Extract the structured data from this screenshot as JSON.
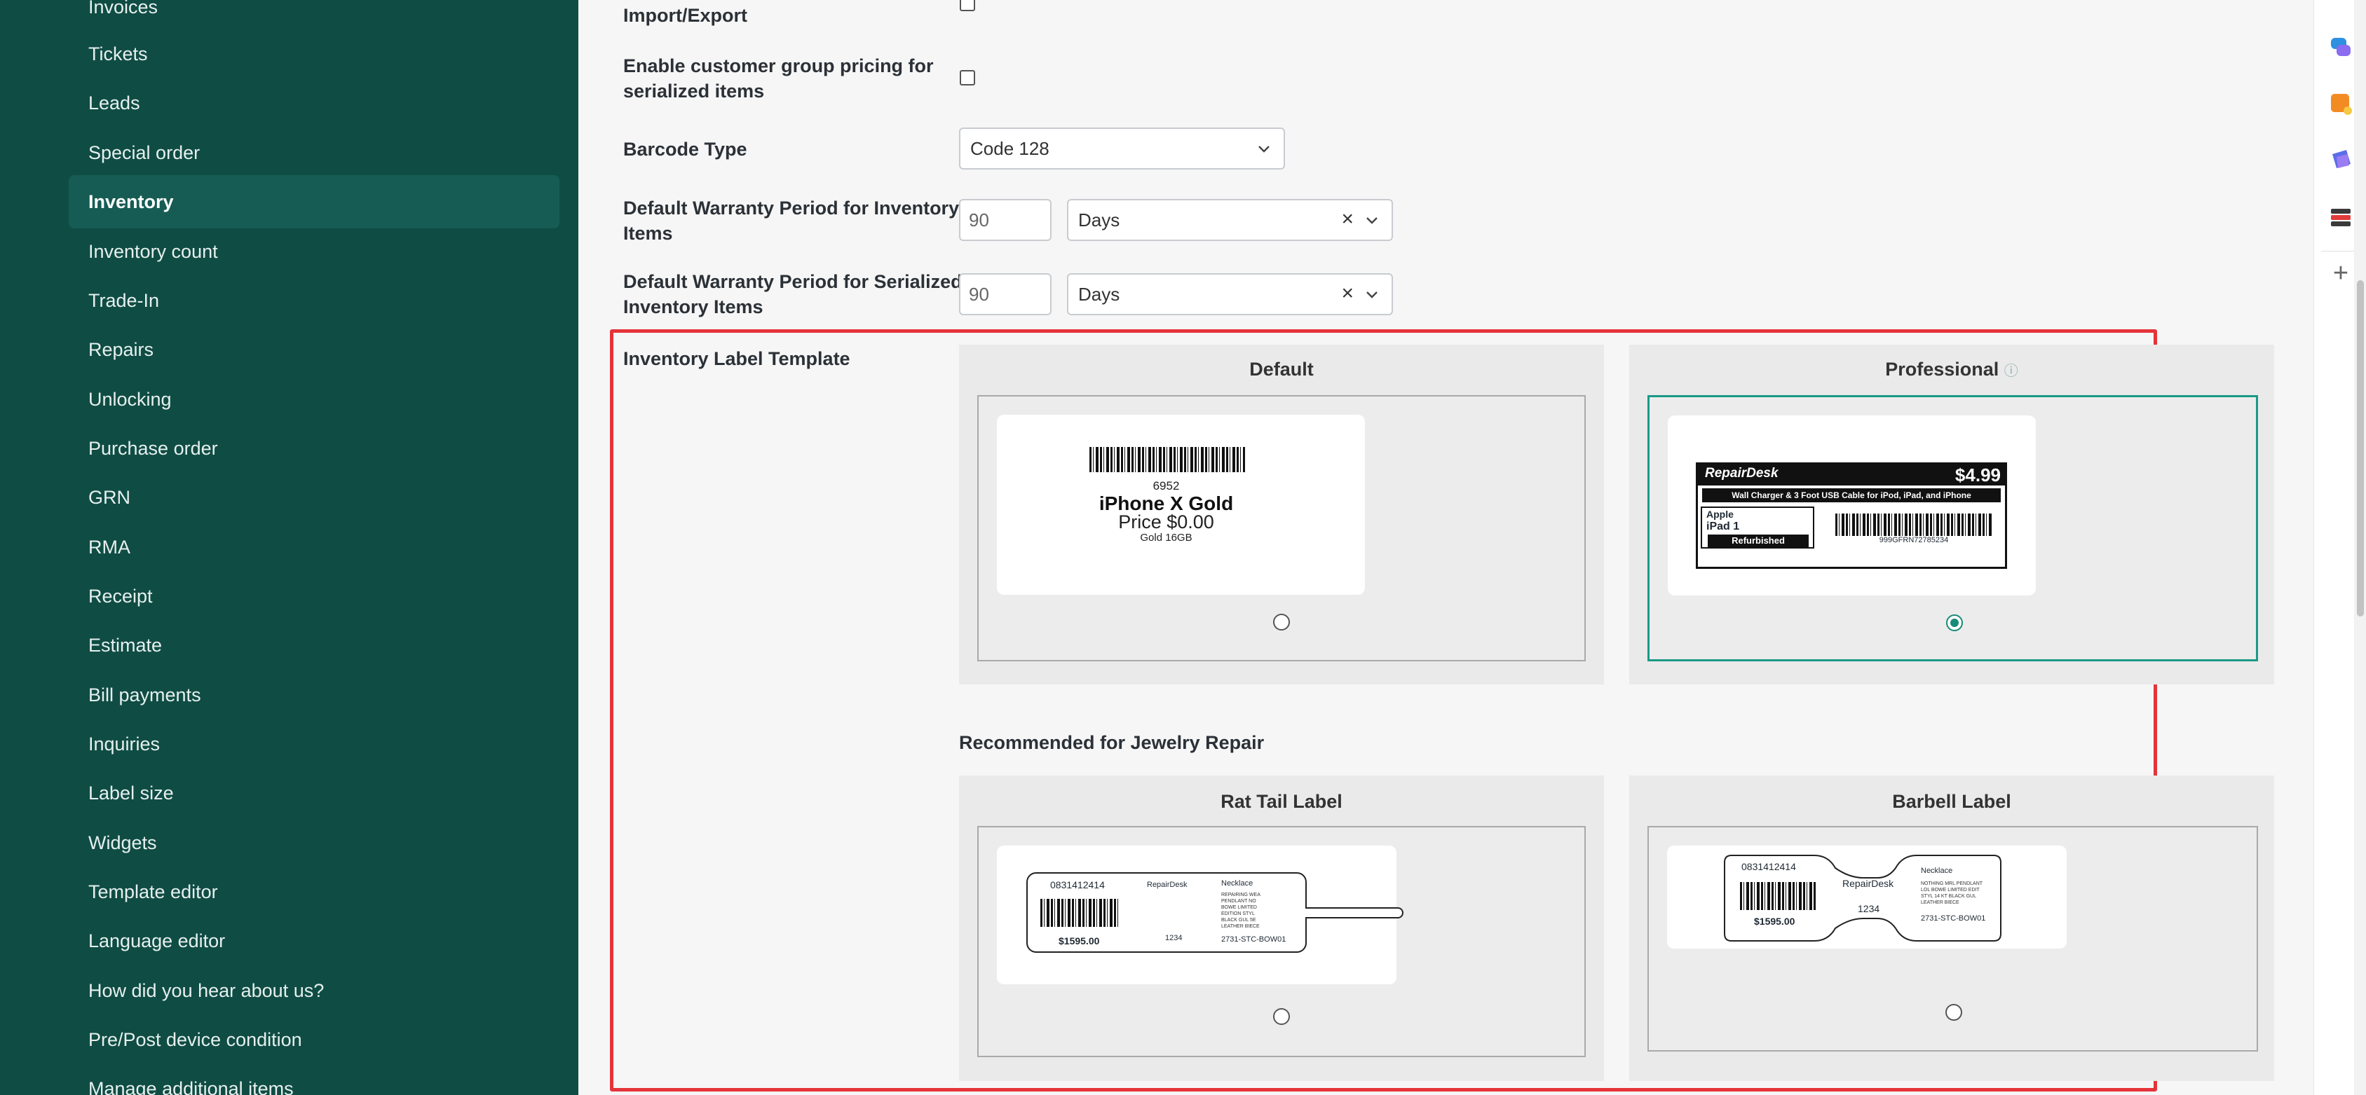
{
  "sidebar": {
    "items": [
      {
        "label": "Invoices"
      },
      {
        "label": "Tickets"
      },
      {
        "label": "Leads"
      },
      {
        "label": "Special order"
      },
      {
        "label": "Inventory",
        "active": true
      },
      {
        "label": "Inventory count"
      },
      {
        "label": "Trade-In"
      },
      {
        "label": "Repairs"
      },
      {
        "label": "Unlocking"
      },
      {
        "label": "Purchase order"
      },
      {
        "label": "GRN"
      },
      {
        "label": "RMA"
      },
      {
        "label": "Receipt"
      },
      {
        "label": "Estimate"
      },
      {
        "label": "Bill payments"
      },
      {
        "label": "Inquiries"
      },
      {
        "label": "Label size"
      },
      {
        "label": "Widgets"
      },
      {
        "label": "Template editor"
      },
      {
        "label": "Language editor"
      },
      {
        "label": "How did you hear about us?"
      },
      {
        "label": "Pre/Post device condition"
      },
      {
        "label": "Manage additional items"
      }
    ]
  },
  "settings": {
    "import_export_label": "Import/Export",
    "group_pricing_label_line1": "Enable customer group pricing for",
    "group_pricing_label_line2": "serialized items",
    "barcode_type_label": "Barcode Type",
    "barcode_type_value": "Code 128",
    "warranty_inventory_label_line1": "Default Warranty Period for Inventory",
    "warranty_inventory_label_line2": "Items",
    "warranty_inventory_value": "90",
    "warranty_inventory_unit": "Days",
    "warranty_serialized_label_line1": "Default Warranty Period for Serialized",
    "warranty_serialized_label_line2": "Inventory Items",
    "warranty_serialized_value": "90",
    "warranty_serialized_unit": "Days",
    "clear_glyph": "×"
  },
  "label_template": {
    "section_label": "Inventory Label Template",
    "default_card": {
      "title": "Default",
      "barcode_number": "6952",
      "product": "iPhone X Gold",
      "price": "Price $0.00",
      "variant": "Gold 16GB",
      "selected": false
    },
    "professional_card": {
      "title": "Professional",
      "info_glyph": "ⓘ",
      "brand": "RepairDesk",
      "price": "$4.99",
      "description": "Wall Charger & 3 Foot USB Cable for iPod, iPad, and iPhone",
      "manufacturer": "Apple",
      "model": "iPad 1",
      "condition": "Refurbished",
      "sku": "999GFRN72785234",
      "selected": true
    },
    "jewelry_heading": "Recommended for Jewelry Repair",
    "rat_tail_card": {
      "title": "Rat Tail Label",
      "code": "0831412414",
      "brand": "RepairDesk",
      "item": "Necklace",
      "details": [
        "REPAIRING WEA",
        "PENDLANT NO",
        "BOWE LIMITED",
        "EDITION STYL",
        "BLACK GUL 5E",
        "LEATHER BIECE"
      ],
      "price": "$1595.00",
      "num": "1234",
      "ref": "2731-STC-BOW01",
      "selected": false
    },
    "barbell_card": {
      "title": "Barbell Label",
      "code": "0831412414",
      "brand": "RepairDesk",
      "item": "Necklace",
      "details": [
        "NOTHING MRL PENDLANT",
        "LOL BOWE LIMITED EDIT",
        "STYL 14 KT BLACK GUL",
        "LEATHER BIECE"
      ],
      "price": "$1595.00",
      "num": "1234",
      "ref": "2731-STC-BOW01",
      "selected": false
    }
  },
  "right_rail": {
    "icons": [
      "chat-bubbles-icon",
      "orange-note-icon",
      "purple-shapes-icon",
      "stacked-books-icon",
      "plus-icon"
    ],
    "plus_glyph": "+"
  }
}
